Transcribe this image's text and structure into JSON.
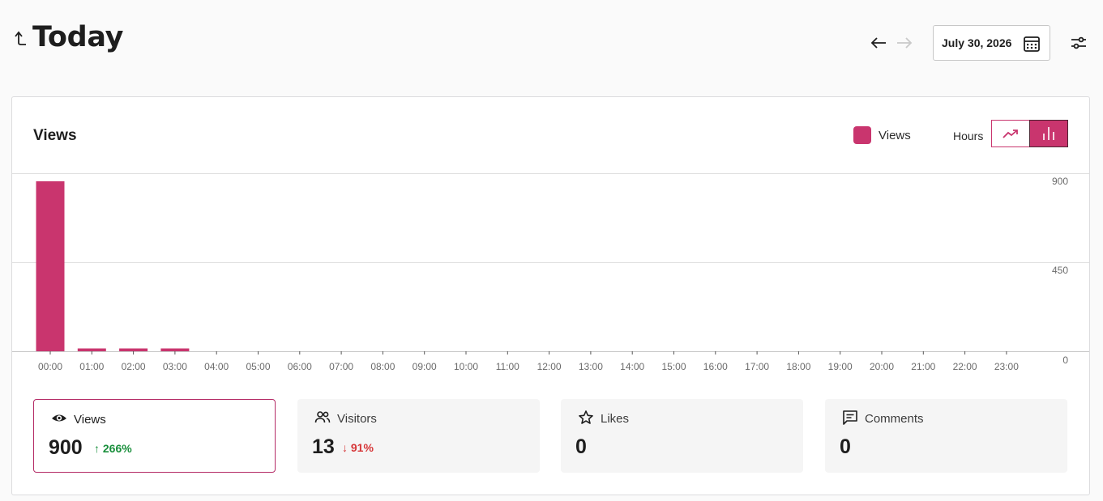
{
  "header": {
    "title": "Today",
    "date": "July 30, 2026"
  },
  "card": {
    "title": "Views",
    "legend_label": "Views",
    "period_label": "Hours",
    "accent_color": "#c9356e"
  },
  "chart_data": {
    "type": "bar",
    "categories": [
      "00:00",
      "01:00",
      "02:00",
      "03:00",
      "04:00",
      "05:00",
      "06:00",
      "07:00",
      "08:00",
      "09:00",
      "10:00",
      "11:00",
      "12:00",
      "13:00",
      "14:00",
      "15:00",
      "16:00",
      "17:00",
      "18:00",
      "19:00",
      "20:00",
      "21:00",
      "22:00",
      "23:00"
    ],
    "series": [
      {
        "name": "Views",
        "values": [
          900,
          15,
          15,
          15,
          0,
          0,
          0,
          0,
          0,
          0,
          0,
          0,
          0,
          0,
          0,
          0,
          0,
          0,
          0,
          0,
          0,
          0,
          0,
          0
        ]
      }
    ],
    "yticks": [
      "900",
      "450",
      "0"
    ],
    "ylim": [
      0,
      900
    ],
    "grid": true
  },
  "stats": [
    {
      "label": "Views",
      "value": "900",
      "change": "266%",
      "direction": "up",
      "icon": "eye-icon",
      "active": true
    },
    {
      "label": "Visitors",
      "value": "13",
      "change": "91%",
      "direction": "down",
      "icon": "people-icon",
      "active": false
    },
    {
      "label": "Likes",
      "value": "0",
      "icon": "star-icon",
      "active": false
    },
    {
      "label": "Comments",
      "value": "0",
      "icon": "comment-icon",
      "active": false
    }
  ]
}
